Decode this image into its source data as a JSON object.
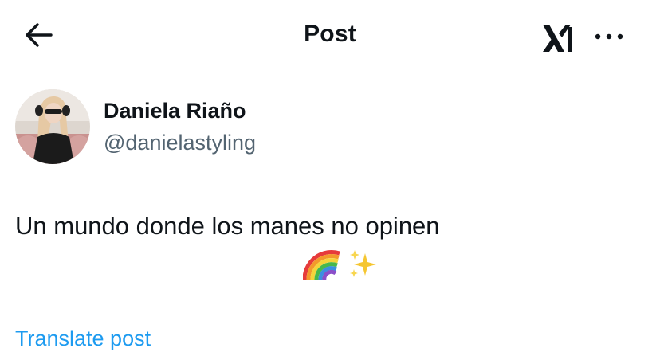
{
  "header": {
    "title": "Post",
    "back_icon": "arrow-left-icon",
    "grok_icon": "grok-logo-icon",
    "more_icon": "more-dots-icon"
  },
  "author": {
    "name": "Daniela Riaño",
    "handle": "@danielastyling"
  },
  "post": {
    "text": "Un mundo donde los manes no opinen",
    "emojis": [
      "rainbow-icon",
      "sparkles-icon"
    ]
  },
  "translate_label": "Translate post",
  "colors": {
    "text": "#0f1419",
    "secondary": "#536471",
    "link": "#1d9bf0"
  }
}
